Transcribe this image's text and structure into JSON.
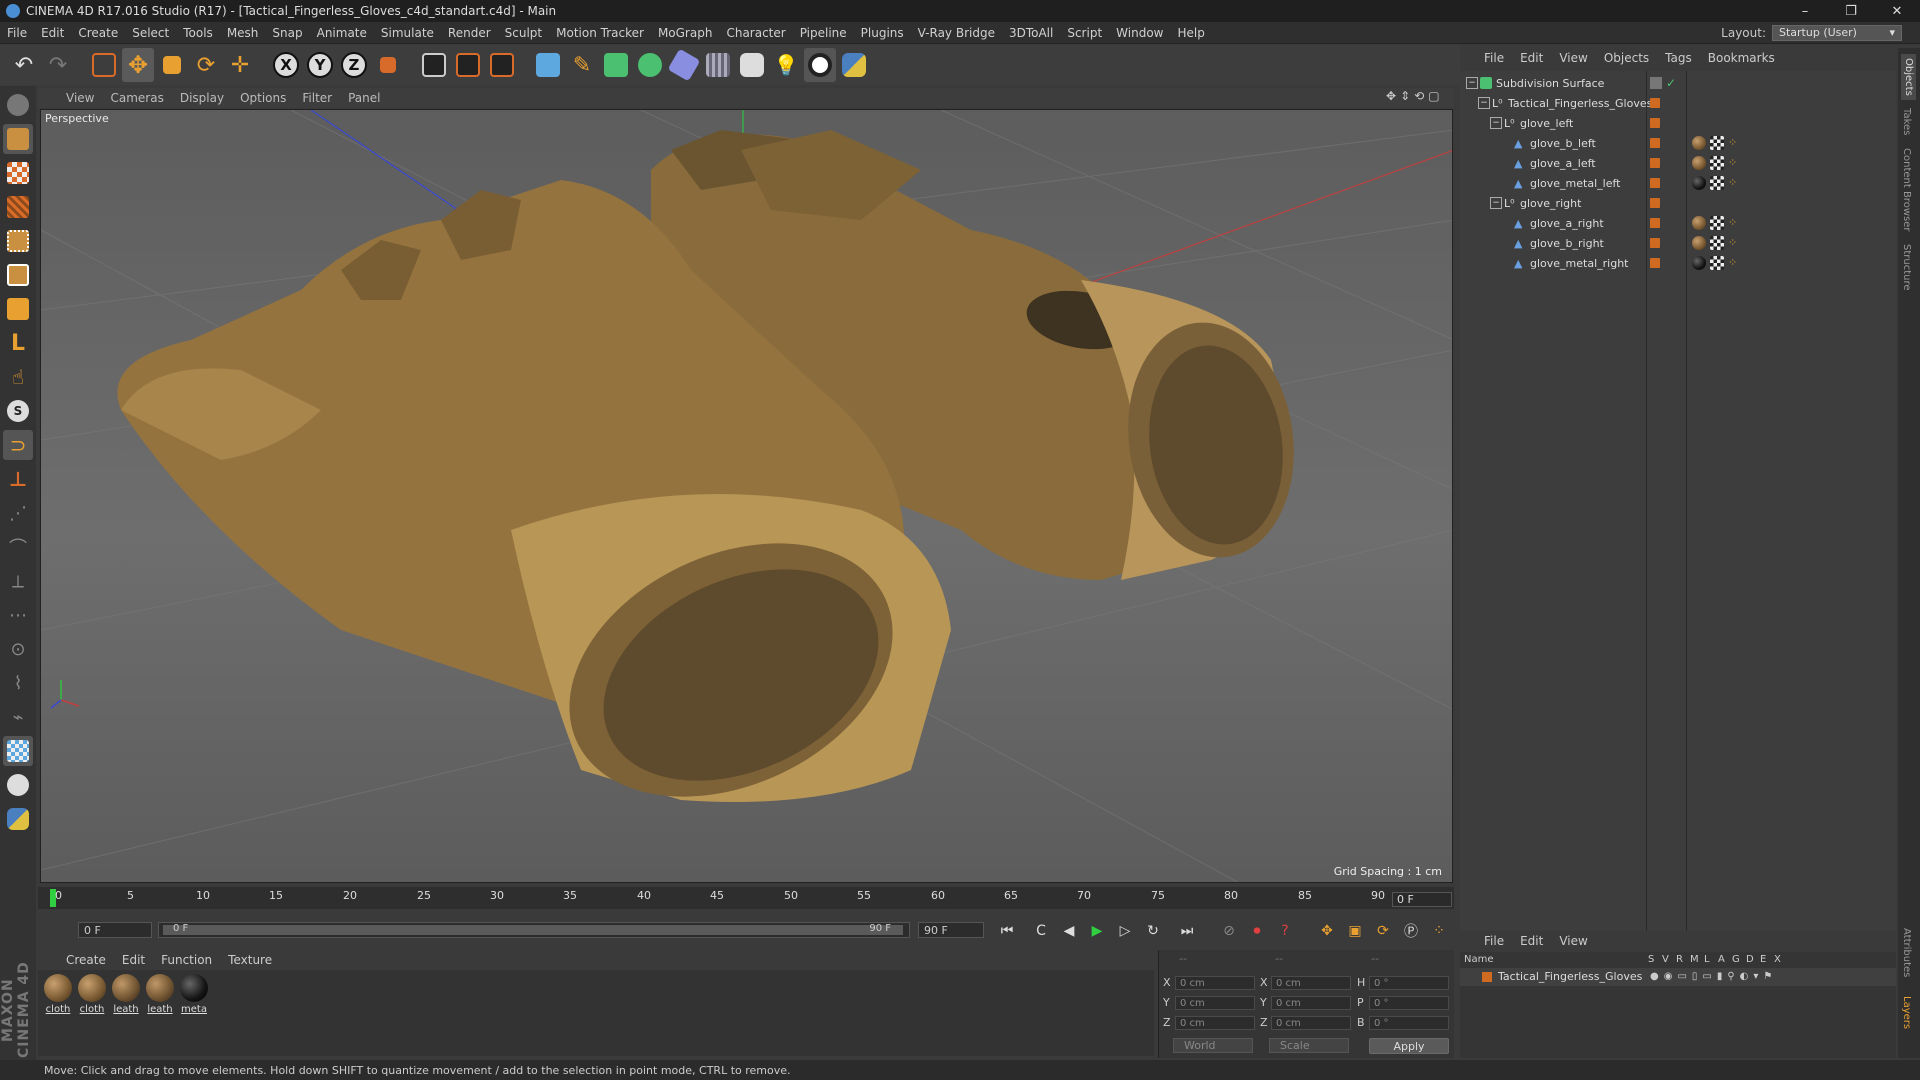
{
  "window": {
    "title": "CINEMA 4D R17.016 Studio (R17) - [Tactical_Fingerless_Gloves_c4d_standart.c4d] - Main",
    "controls": [
      "–",
      "❐",
      "✕"
    ]
  },
  "menubar": {
    "items": [
      "File",
      "Edit",
      "Create",
      "Select",
      "Tools",
      "Mesh",
      "Snap",
      "Animate",
      "Simulate",
      "Render",
      "Sculpt",
      "Motion Tracker",
      "MoGraph",
      "Character",
      "Pipeline",
      "Plugins",
      "V-Ray Bridge",
      "3DToAll",
      "Script",
      "Window",
      "Help"
    ],
    "layout_label": "Layout:",
    "layout_value": "Startup (User)"
  },
  "toolbar": {
    "axis": [
      "X",
      "Y",
      "Z"
    ]
  },
  "viewport": {
    "menu": [
      "View",
      "Cameras",
      "Display",
      "Options",
      "Filter",
      "Panel"
    ],
    "label": "Perspective",
    "grid_spacing": "Grid Spacing : 1 cm"
  },
  "timeline": {
    "ticks": [
      "0",
      "5",
      "10",
      "15",
      "20",
      "25",
      "30",
      "35",
      "40",
      "45",
      "50",
      "55",
      "60",
      "65",
      "70",
      "75",
      "80",
      "85",
      "90"
    ],
    "current_frame": "0 F",
    "start_field": "0 F",
    "range_start": "0 F",
    "range_end": "90 F",
    "end_field": "90 F"
  },
  "materials": {
    "menu": [
      "Create",
      "Edit",
      "Function",
      "Texture"
    ],
    "items": [
      {
        "name": "cloth",
        "color": "#7a5a32"
      },
      {
        "name": "cloth",
        "color": "#7a5a32"
      },
      {
        "name": "leath",
        "color": "#6e5230"
      },
      {
        "name": "leath",
        "color": "#6e5230"
      },
      {
        "name": "meta",
        "color": "#141414"
      }
    ]
  },
  "coordinates": {
    "header": [
      "--",
      "--",
      "--"
    ],
    "rows": [
      {
        "l1": "X",
        "v1": "0 cm",
        "l2": "X",
        "v2": "0 cm",
        "l3": "H",
        "v3": "0 °"
      },
      {
        "l1": "Y",
        "v1": "0 cm",
        "l2": "Y",
        "v2": "0 cm",
        "l3": "P",
        "v3": "0 °"
      },
      {
        "l1": "Z",
        "v1": "0 cm",
        "l2": "Z",
        "v2": "0 cm",
        "l3": "B",
        "v3": "0 °"
      }
    ],
    "mode1": "World",
    "mode2": "Scale",
    "apply": "Apply"
  },
  "status": "Move: Click and drag to move elements. Hold down SHIFT to quantize movement / add to the selection in point mode, CTRL to remove.",
  "object_manager": {
    "menu": [
      "File",
      "Edit",
      "View",
      "Objects",
      "Tags",
      "Bookmarks"
    ],
    "objects": [
      {
        "name": "Subdivision Surface",
        "depth": 0,
        "kind": "subdiv"
      },
      {
        "name": "Tactical_Fingerless_Gloves",
        "depth": 1,
        "kind": "null"
      },
      {
        "name": "glove_left",
        "depth": 2,
        "kind": "null"
      },
      {
        "name": "glove_b_left",
        "depth": 3,
        "kind": "poly",
        "mat": "#7a5a32"
      },
      {
        "name": "glove_a_left",
        "depth": 3,
        "kind": "poly",
        "mat": "#7a5a32"
      },
      {
        "name": "glove_metal_left",
        "depth": 3,
        "kind": "poly",
        "mat": "#141414"
      },
      {
        "name": "glove_right",
        "depth": 2,
        "kind": "null"
      },
      {
        "name": "glove_a_right",
        "depth": 3,
        "kind": "poly",
        "mat": "#7a5a32"
      },
      {
        "name": "glove_b_right",
        "depth": 3,
        "kind": "poly",
        "mat": "#7a5a32"
      },
      {
        "name": "glove_metal_right",
        "depth": 3,
        "kind": "poly",
        "mat": "#141414"
      }
    ]
  },
  "side_tabs": [
    "Objects",
    "Takes",
    "Content Browser",
    "Structure",
    "Attributes",
    "Layers"
  ],
  "layer_manager": {
    "menu": [
      "File",
      "Edit",
      "View"
    ],
    "columns": [
      "Name",
      "S",
      "V",
      "R",
      "M",
      "L",
      "A",
      "G",
      "D",
      "E",
      "X"
    ],
    "rows": [
      {
        "name": "Tactical_Fingerless_Gloves",
        "color": "#d06a20"
      }
    ]
  },
  "logo": "MAXON CINEMA 4D",
  "colors": {
    "accent_orange": "#d06a20",
    "glove_tan": "#b08a4e"
  }
}
